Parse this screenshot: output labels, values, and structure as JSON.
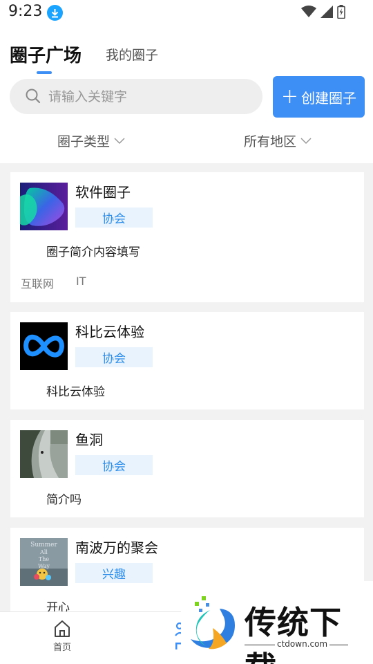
{
  "status_bar": {
    "time": "9:23"
  },
  "tabs": {
    "active": "圈子广场",
    "inactive": "我的圈子"
  },
  "search": {
    "placeholder": "请输入关键字",
    "value": ""
  },
  "create_button": {
    "label": "创建圈子"
  },
  "filters": {
    "type_label": "圈子类型",
    "region_label": "所有地区"
  },
  "cards": [
    {
      "title": "软件圈子",
      "badge": "协会",
      "description": "圈子简介内容填写",
      "tags": [
        "互联网",
        "IT"
      ]
    },
    {
      "title": "科比云体验",
      "badge": "协会",
      "description": "科比云体验",
      "tags": []
    },
    {
      "title": "鱼洞",
      "badge": "协会",
      "description": "简介吗",
      "tags": []
    },
    {
      "title": "南波万的聚会",
      "badge": "兴趣",
      "description": "开心",
      "tags": []
    }
  ],
  "card4_image_text": [
    "Summer",
    "All",
    "The",
    "Way"
  ],
  "bottom_nav": {
    "home_label": "首页"
  },
  "watermark": {
    "name": "传统下载",
    "url": "ctdown.com"
  },
  "colors": {
    "accent": "#3d8ff5",
    "badge_bg": "#e8f3fd",
    "badge_text": "#2f8eea"
  }
}
